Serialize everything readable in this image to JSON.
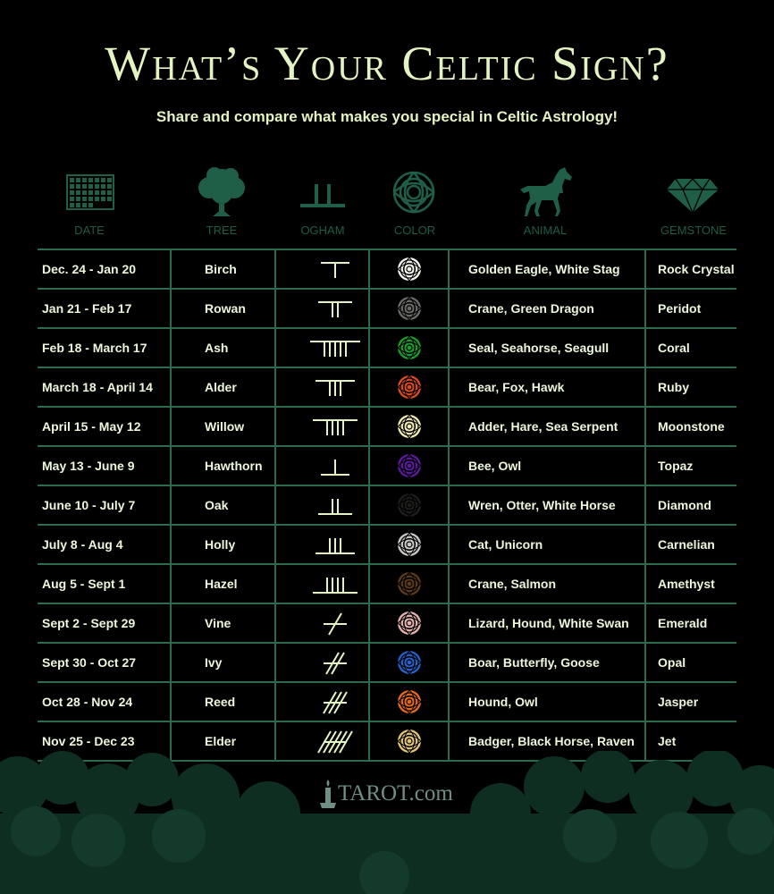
{
  "header": {
    "title": "What’s Your Celtic Sign?",
    "subtitle": "Share and compare what makes you special in Celtic Astrology!"
  },
  "columns": {
    "date": "DATE",
    "tree": "TREE",
    "ogham": "OGHAM",
    "color": "COLOR",
    "animal": "ANIMAL",
    "gemstone": "GEMSTONE"
  },
  "icons": {
    "date": "calendar-icon",
    "tree": "tree-icon",
    "ogham": "ogham-icon",
    "color": "celtic-knot-icon",
    "animal": "horse-icon",
    "gemstone": "diamond-icon"
  },
  "colors": {
    "accent": "#2b6b4d",
    "title_text": "#e4f3c2",
    "header_label": "#1d5c45",
    "row_text": "#ecf7db"
  },
  "rows": [
    {
      "date": "Dec. 24 - Jan 20",
      "tree": "Birch",
      "ogham": {
        "type": "below",
        "count": 1
      },
      "color": "#f2f2ec",
      "animal": "Golden Eagle, White Stag",
      "gemstone": "Rock Crystal"
    },
    {
      "date": "Jan 21 - Feb 17",
      "tree": "Rowan",
      "ogham": {
        "type": "below",
        "count": 2
      },
      "color": "#6a6a66",
      "animal": "Crane, Green Dragon",
      "gemstone": "Peridot"
    },
    {
      "date": "Feb 18 - March 17",
      "tree": "Ash",
      "ogham": {
        "type": "below",
        "count": 5
      },
      "color": "#1c9a2c",
      "animal": "Seal, Seahorse, Seagull",
      "gemstone": "Coral"
    },
    {
      "date": "March 18 - April 14",
      "tree": "Alder",
      "ogham": {
        "type": "below",
        "count": 3
      },
      "color": "#d94a1e",
      "animal": "Bear, Fox, Hawk",
      "gemstone": "Ruby"
    },
    {
      "date": "April 15 - May 12",
      "tree": "Willow",
      "ogham": {
        "type": "below",
        "count": 4
      },
      "color": "#ece8b0",
      "animal": "Adder, Hare, Sea Serpent",
      "gemstone": "Moonstone"
    },
    {
      "date": "May 13 - June 9",
      "tree": "Hawthorn",
      "ogham": {
        "type": "above",
        "count": 1
      },
      "color": "#5a1a9c",
      "animal": "Bee, Owl",
      "gemstone": "Topaz"
    },
    {
      "date": "June 10 - July 7",
      "tree": "Oak",
      "ogham": {
        "type": "above",
        "count": 2
      },
      "color": "#1e1e1c",
      "animal": "Wren, Otter, White Horse",
      "gemstone": "Diamond"
    },
    {
      "date": "July 8 - Aug 4",
      "tree": "Holly",
      "ogham": {
        "type": "above",
        "count": 3
      },
      "color": "#c8c8c4",
      "animal": "Cat, Unicorn",
      "gemstone": "Carnelian"
    },
    {
      "date": "Aug 5 - Sept 1",
      "tree": "Hazel",
      "ogham": {
        "type": "above",
        "count": 4
      },
      "color": "#5c3a1c",
      "animal": "Crane, Salmon",
      "gemstone": "Amethyst"
    },
    {
      "date": "Sept 2 - Sept 29",
      "tree": "Vine",
      "ogham": {
        "type": "diagonal",
        "count": 1
      },
      "color": "#e2b0b0",
      "animal": "Lizard, Hound, White Swan",
      "gemstone": "Emerald"
    },
    {
      "date": "Sept 30 - Oct 27",
      "tree": "Ivy",
      "ogham": {
        "type": "diagonal",
        "count": 2
      },
      "color": "#2660c8",
      "animal": "Boar, Butterfly, Goose",
      "gemstone": "Opal"
    },
    {
      "date": "Oct 28 - Nov 24",
      "tree": "Reed",
      "ogham": {
        "type": "diagonal",
        "count": 3
      },
      "color": "#e4681c",
      "animal": "Hound, Owl",
      "gemstone": "Jasper"
    },
    {
      "date": "Nov 25 - Dec 23",
      "tree": "Elder",
      "ogham": {
        "type": "diagonal",
        "count": 5
      },
      "color": "#e2c474",
      "animal": "Badger, Black Horse, Raven",
      "gemstone": "Jet"
    }
  ],
  "footer": {
    "brand": "TAROT.com",
    "brand_icon": "candle-icon"
  }
}
